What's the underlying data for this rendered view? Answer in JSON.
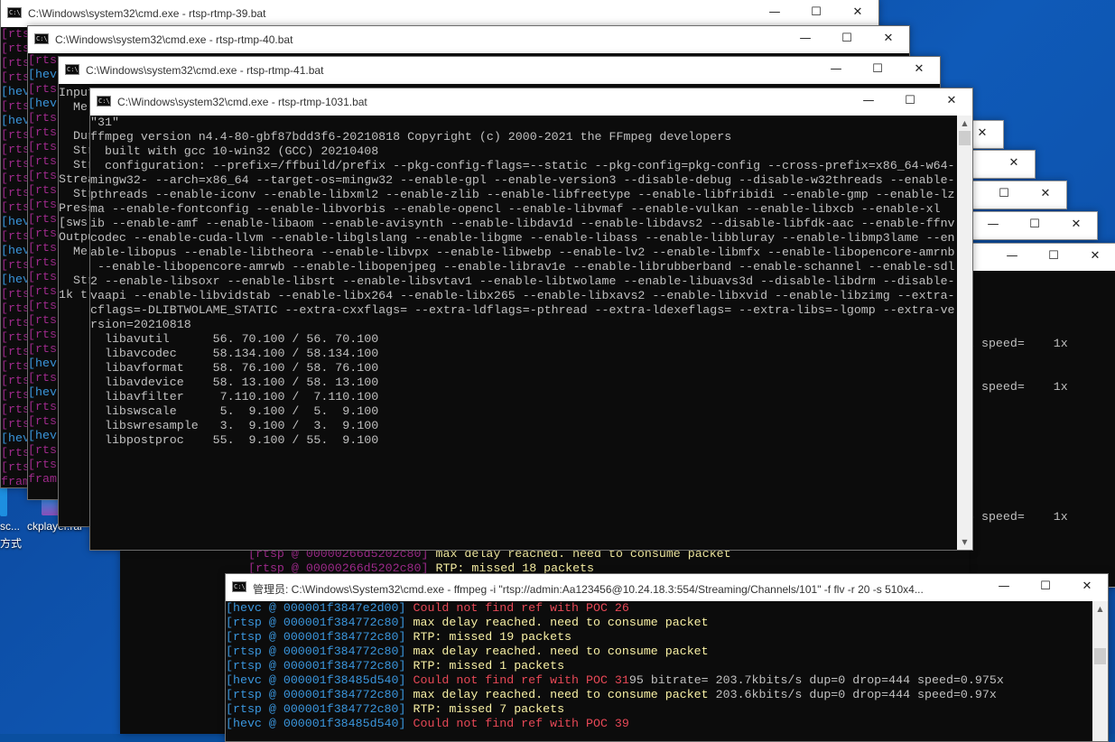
{
  "titlebar_buttons": {
    "min": "—",
    "max": "☐",
    "close": "✕"
  },
  "icon_text": "C:\\",
  "desktop_icons": {
    "left_label": "sc...",
    "left_label2": "方式",
    "ckplayer": "ckplayer.rar"
  },
  "windows": {
    "w39": {
      "title": "C:\\Windows\\system32\\cmd.exe - rtsp-rtmp-39.bat"
    },
    "w40": {
      "title": "C:\\Windows\\system32\\cmd.exe - rtsp-rtmp-40.bat"
    },
    "w41": {
      "title": "C:\\Windows\\system32\\cmd.exe - rtsp-rtmp-41.bat"
    },
    "w1031": {
      "title": "C:\\Windows\\system32\\cmd.exe - rtsp-rtmp-1031.bat",
      "lines": [
        "\"31\"",
        "ffmpeg version n4.4-80-gbf87bdd3f6-20210818 Copyright (c) 2000-2021 the FFmpeg developers",
        "  built with gcc 10-win32 (GCC) 20210408",
        "  configuration: --prefix=/ffbuild/prefix --pkg-config-flags=--static --pkg-config=pkg-config --cross-prefix=x86_64-w64-",
        "mingw32- --arch=x86_64 --target-os=mingw32 --enable-gpl --enable-version3 --disable-debug --disable-w32threads --enable-",
        "pthreads --enable-iconv --enable-libxml2 --enable-zlib --enable-libfreetype --enable-libfribidi --enable-gmp --enable-lz",
        "ma --enable-fontconfig --enable-libvorbis --enable-opencl --enable-libvmaf --enable-vulkan --enable-libxcb --enable-xl",
        "ib --enable-amf --enable-libaom --enable-avisynth --enable-libdav1d --enable-libdavs2 --disable-libfdk-aac --enable-ffnv",
        "codec --enable-cuda-llvm --enable-libglslang --enable-libgme --enable-libass --enable-libbluray --enable-libmp3lame --en",
        "able-libopus --enable-libtheora --enable-libvpx --enable-libwebp --enable-lv2 --enable-libmfx --enable-libopencore-amrnb",
        " --enable-libopencore-amrwb --enable-libopenjpeg --enable-librav1e --enable-librubberband --enable-schannel --enable-sdl",
        "2 --enable-libsoxr --enable-libsrt --enable-libsvtav1 --enable-libtwolame --enable-libuavs3d --disable-libdrm --disable-",
        "vaapi --enable-libvidstab --enable-libx264 --enable-libx265 --enable-libxavs2 --enable-libxvid --enable-libzimg --extra-",
        "cflags=-DLIBTWOLAME_STATIC --extra-cxxflags= --extra-ldflags=-pthread --extra-ldexeflags= --extra-libs=-lgomp --extra-ve",
        "rsion=20210818",
        "  libavutil      56. 70.100 / 56. 70.100",
        "  libavcodec     58.134.100 / 58.134.100",
        "  libavformat    58. 76.100 / 58. 76.100",
        "  libavdevice    58. 13.100 / 58. 13.100",
        "  libavfilter     7.110.100 /  7.110.100",
        "  libswscale      5.  9.100 /  5.  9.100",
        "  libswresample   3.  9.100 /  3.  9.100",
        "  libpostproc    55.  9.100 / 55.  9.100"
      ]
    },
    "admin": {
      "title": "管理员: C:\\Windows\\System32\\cmd.exe - ffmpeg  -i \"rtsp://admin:Aa123456@10.24.18.3:554/Streaming/Channels/101\" -f flv -r 20 -s 510x4...",
      "lines": [
        {
          "tag": "[hevc @ 000001f3847e2d00]",
          "msg": "Could not find ref with POC 26",
          "tail": "",
          "cls": "red"
        },
        {
          "tag": "[rtsp @ 000001f384772c80]",
          "msg": "max delay reached. need to consume packet",
          "tail": "",
          "cls": "yel"
        },
        {
          "tag": "[rtsp @ 000001f384772c80]",
          "msg": "RTP: missed 19 packets",
          "tail": "",
          "cls": "yel"
        },
        {
          "tag": "[rtsp @ 000001f384772c80]",
          "msg": "max delay reached. need to consume packet",
          "tail": "",
          "cls": "yel"
        },
        {
          "tag": "[rtsp @ 000001f384772c80]",
          "msg": "RTP: missed 1 packets",
          "tail": "",
          "cls": "yel"
        },
        {
          "tag": "[hevc @ 000001f38485d540]",
          "msg": "Could not find ref with POC 31",
          "tail": "95 bitrate= 203.7kbits/s dup=0 drop=444 speed=0.975x",
          "cls": "red"
        },
        {
          "tag": "[rtsp @ 000001f384772c80]",
          "msg": "max delay reached. need to consume packet",
          "tail": " 203.6kbits/s dup=0 drop=444 speed=0.97x",
          "cls": "yel"
        },
        {
          "tag": "[rtsp @ 000001f384772c80]",
          "msg": "RTP: missed 7 packets",
          "tail": "",
          "cls": "yel"
        },
        {
          "tag": "[hevc @ 000001f38485d540]",
          "msg": "Could not find ref with POC 39",
          "tail": "",
          "cls": "red"
        }
      ]
    },
    "mid": {
      "lines": [
        {
          "tag": "[rtsp @ 00000266d5202c80]",
          "msg": "max delay reached. need to consume packet"
        },
        {
          "tag": "[rtsp @ 00000266d5202c80]",
          "msg": "RTP: missed 18 packets"
        }
      ]
    },
    "right": {
      "speed1": "2 speed=    1x",
      "speed2": "2 speed=    1x",
      "speed3": "6 speed=    1x"
    },
    "bg": {
      "col1": [
        "[rts",
        "[rts",
        "[rts",
        "[rts",
        "[hev",
        "[rts",
        "[hev",
        "[rts",
        "[rts",
        "[rts",
        "[rts",
        "[rts",
        "[rts",
        "[hev",
        "[rts",
        "[hev",
        "[rts",
        "[hev",
        "[rts",
        "[rts",
        "[rts",
        "[rts",
        "[rts",
        "[rts",
        "[rts",
        "[rts",
        "[rts",
        "[rts",
        "[hev",
        "[rts",
        "[rts",
        "fram"
      ],
      "col2": [
        "[rts",
        "[hev",
        "[rts",
        "[hev",
        "[rts",
        "[rts",
        "[rts",
        "[rts",
        "[rts",
        "[rts",
        "[rts",
        "[rts",
        "[rts",
        "[rts",
        "[rts",
        "[rts",
        "[rts",
        "[rts",
        "[rts",
        "[rts",
        "[rts",
        "[hev",
        "[rts",
        "[hev",
        "[rts",
        "[rts",
        "[hev",
        "[rts",
        "[rts",
        "fram"
      ],
      "col3": [
        "Input",
        "  Me",
        "",
        "  Dur",
        "  Str",
        "  Str",
        "Strea",
        "  Str",
        "Press",
        "[sws",
        "Outpu",
        "  Me",
        "",
        "  Str",
        "1k t"
      ]
    }
  }
}
